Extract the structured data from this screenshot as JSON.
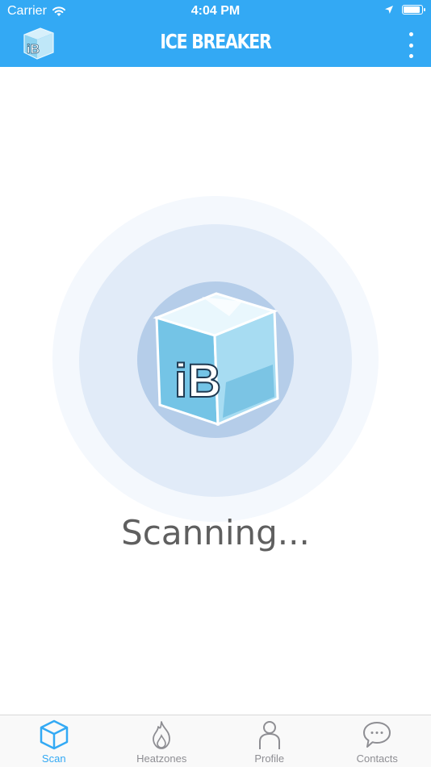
{
  "status_bar": {
    "carrier": "Carrier",
    "time": "4:04 PM",
    "battery_level": 0.95
  },
  "header": {
    "title": "ICE BREAKER",
    "logo_text": "iB"
  },
  "scanner": {
    "logo_text": "iB",
    "status_text": "Scanning..."
  },
  "tab_bar": {
    "tabs": [
      {
        "label": "Scan",
        "icon": "ice-cube-icon",
        "active": true
      },
      {
        "label": "Heatzones",
        "icon": "flame-icon",
        "active": false
      },
      {
        "label": "Profile",
        "icon": "person-icon",
        "active": false
      },
      {
        "label": "Contacts",
        "icon": "chat-bubble-icon",
        "active": false
      }
    ]
  },
  "colors": {
    "brand_blue": "#33a9f4",
    "inactive_gray": "#8e8e93",
    "ring_outer": "#f4f8fd",
    "ring_middle": "#e1ebf8",
    "ring_inner": "#b5cde9"
  }
}
